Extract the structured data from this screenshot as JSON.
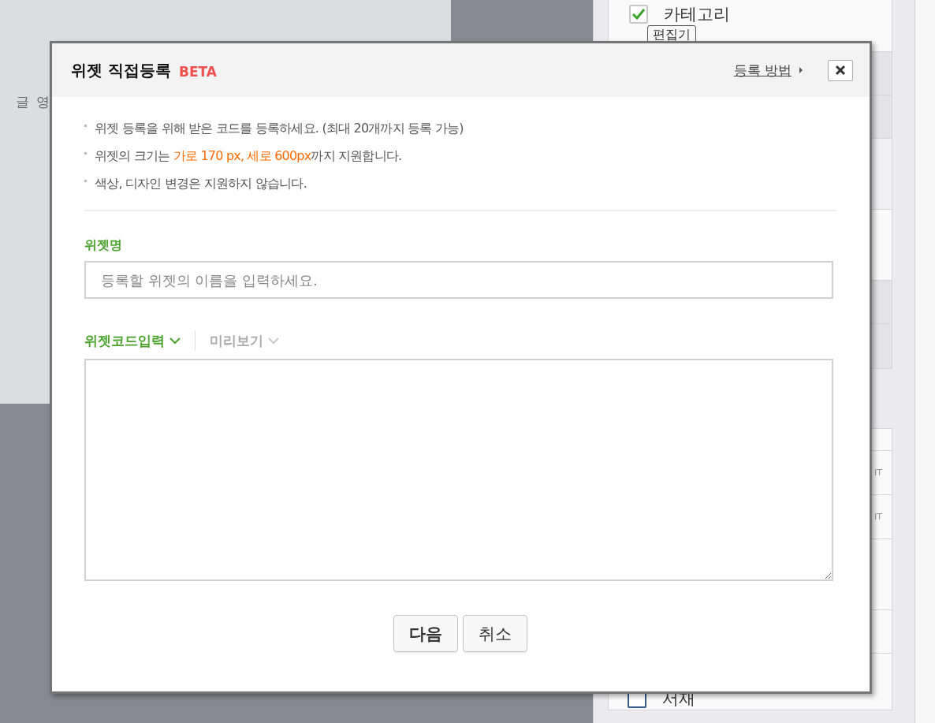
{
  "background": {
    "left_label": "글 영",
    "sidebar_top": {
      "checkbox": {
        "label": "카테고리",
        "checked": true
      },
      "button": "편집기"
    },
    "sidebar_rows": [
      "IT",
      "IT"
    ],
    "sidebar_bottom": {
      "checkbox": {
        "label": "서재",
        "checked": false
      }
    }
  },
  "dialog": {
    "title": "위젯 직접등록",
    "badge": "BETA",
    "help_link": "등록 방법",
    "notes": [
      "위젯 등록을 위해 받은 코드를 등록하세요. (최대 20개까지 등록 가능)",
      "위젯의 크기는 **가로 170 px, 세로 600px**까지 지원합니다.",
      "색상, 디자인 변경은 지원하지 않습니다."
    ],
    "name_label": "위젯명",
    "name_field": {
      "placeholder": "등록할 위젯의 이름을 입력하세요."
    },
    "code_tabs": [
      {
        "label": "위젯코드입력",
        "selected": true
      },
      {
        "label": "미리보기",
        "selected": false
      }
    ],
    "buttons": [
      {
        "label": "다음",
        "kind": "primary"
      },
      {
        "label": "취소",
        "kind": "secondary"
      }
    ]
  }
}
